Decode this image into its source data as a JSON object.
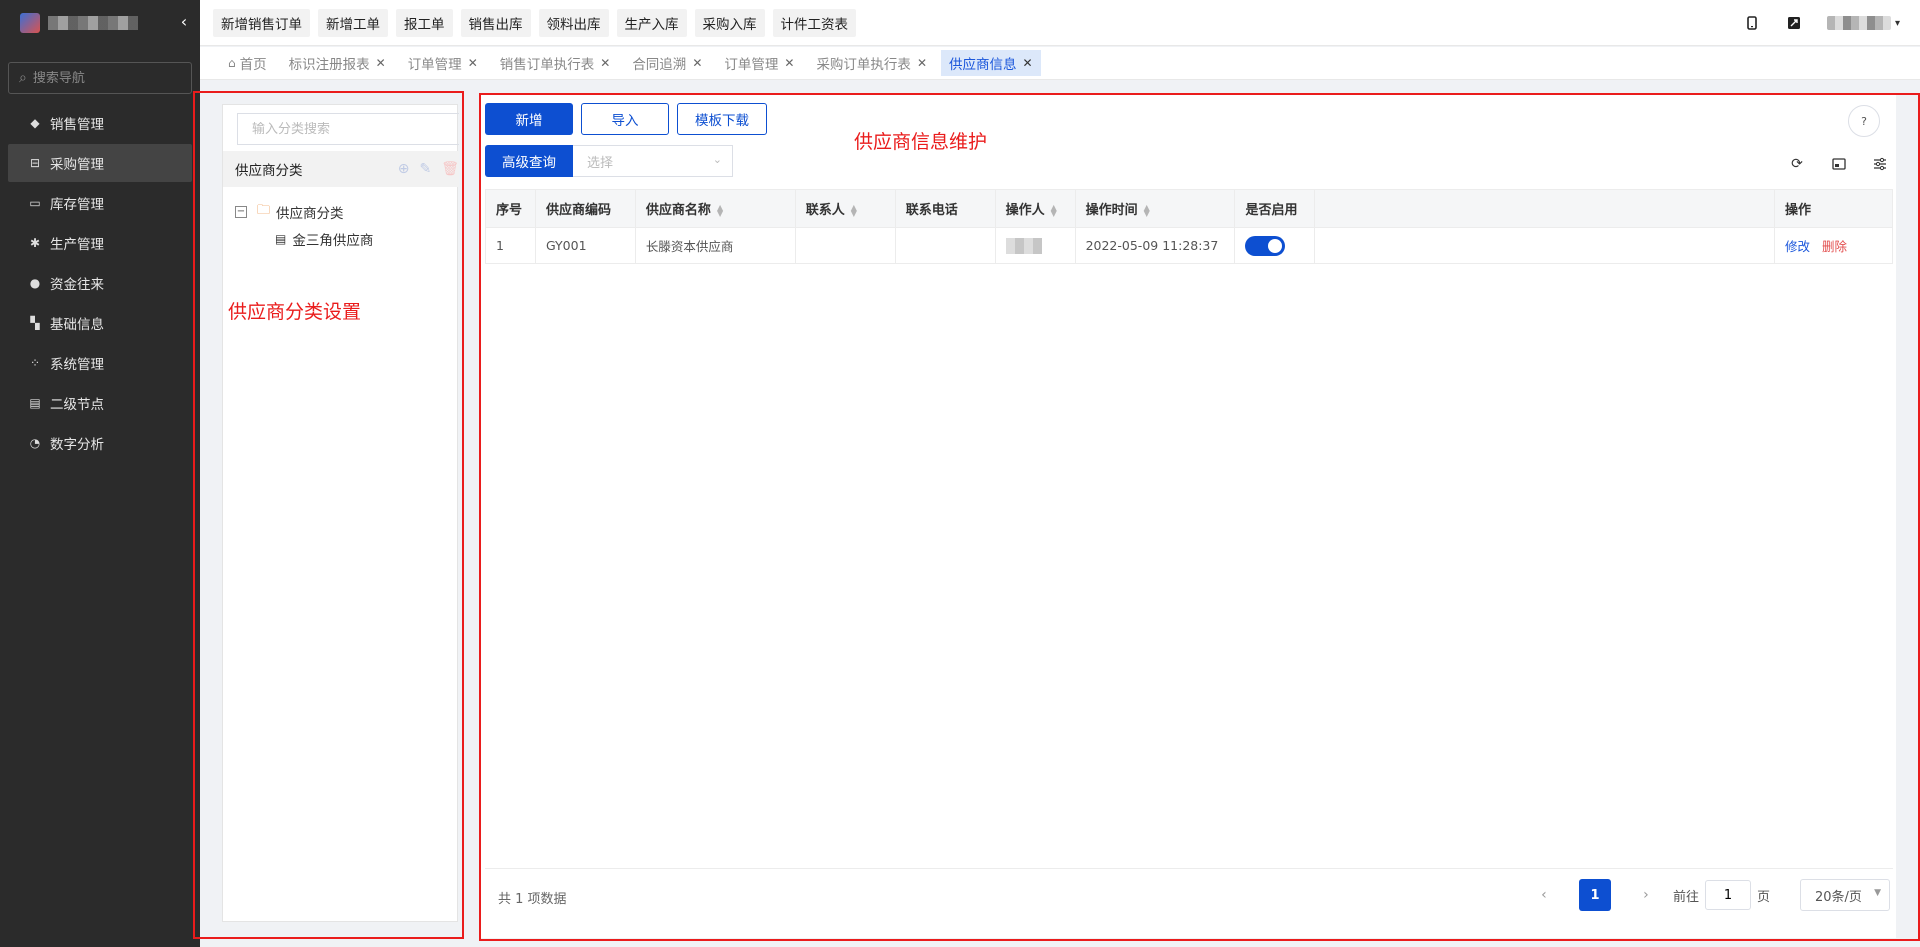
{
  "sidebar": {
    "collapse_icon": "chevron-left-icon",
    "search_placeholder": "搜索导航",
    "items": [
      {
        "label": "销售管理",
        "icon": "tag-icon"
      },
      {
        "label": "采购管理",
        "icon": "cart-icon",
        "active": true
      },
      {
        "label": "库存管理",
        "icon": "box-icon"
      },
      {
        "label": "生产管理",
        "icon": "cog-icon"
      },
      {
        "label": "资金往来",
        "icon": "coin-icon"
      },
      {
        "label": "基础信息",
        "icon": "grid-icon"
      },
      {
        "label": "系统管理",
        "icon": "apps-icon"
      },
      {
        "label": "二级节点",
        "icon": "doc-icon"
      },
      {
        "label": "数字分析",
        "icon": "pie-icon"
      }
    ]
  },
  "topbar": {
    "quick_buttons": [
      "新增销售订单",
      "新增工单",
      "报工单",
      "销售出库",
      "领料出库",
      "生产入库",
      "采购入库",
      "计件工资表"
    ]
  },
  "tabs": [
    {
      "label": "首页"
    },
    {
      "label": "标识注册报表"
    },
    {
      "label": "订单管理"
    },
    {
      "label": "销售订单执行表"
    },
    {
      "label": "合同追溯"
    },
    {
      "label": "订单管理"
    },
    {
      "label": "采购订单执行表"
    },
    {
      "label": "供应商信息",
      "active": true
    }
  ],
  "left_panel": {
    "search_placeholder": "输入分类搜索",
    "header": "供应商分类",
    "tree": {
      "root": "供应商分类",
      "children": [
        "金三角供应商"
      ]
    },
    "annotation": "供应商分类设置"
  },
  "main": {
    "buttons": {
      "add": "新增",
      "import": "导入",
      "template": "模板下载"
    },
    "advanced_query": "高级查询",
    "select_placeholder": "选择",
    "annotation": "供应商信息维护",
    "table": {
      "columns": [
        "序号",
        "供应商编码",
        "供应商名称",
        "联系人",
        "联系电话",
        "操作人",
        "操作时间",
        "是否启用",
        "",
        "操作"
      ],
      "rows": [
        {
          "index": "1",
          "code": "GY001",
          "name": "长滕资本供应商",
          "contact": "",
          "phone": "",
          "time": "2022-05-09 11:28:37",
          "enabled": true,
          "edit": "修改",
          "delete": "删除"
        }
      ]
    },
    "footer": {
      "total": "共 1 项数据",
      "current_page": "1",
      "goto_label": "前往",
      "goto_value": "1",
      "page_unit": "页",
      "page_size": "20条/页"
    }
  },
  "colors": {
    "primary": "#0d4fd1",
    "sidebar_bg": "#2b2b2b",
    "annotation": "#ea1c1c",
    "danger": "#e24c4c"
  }
}
